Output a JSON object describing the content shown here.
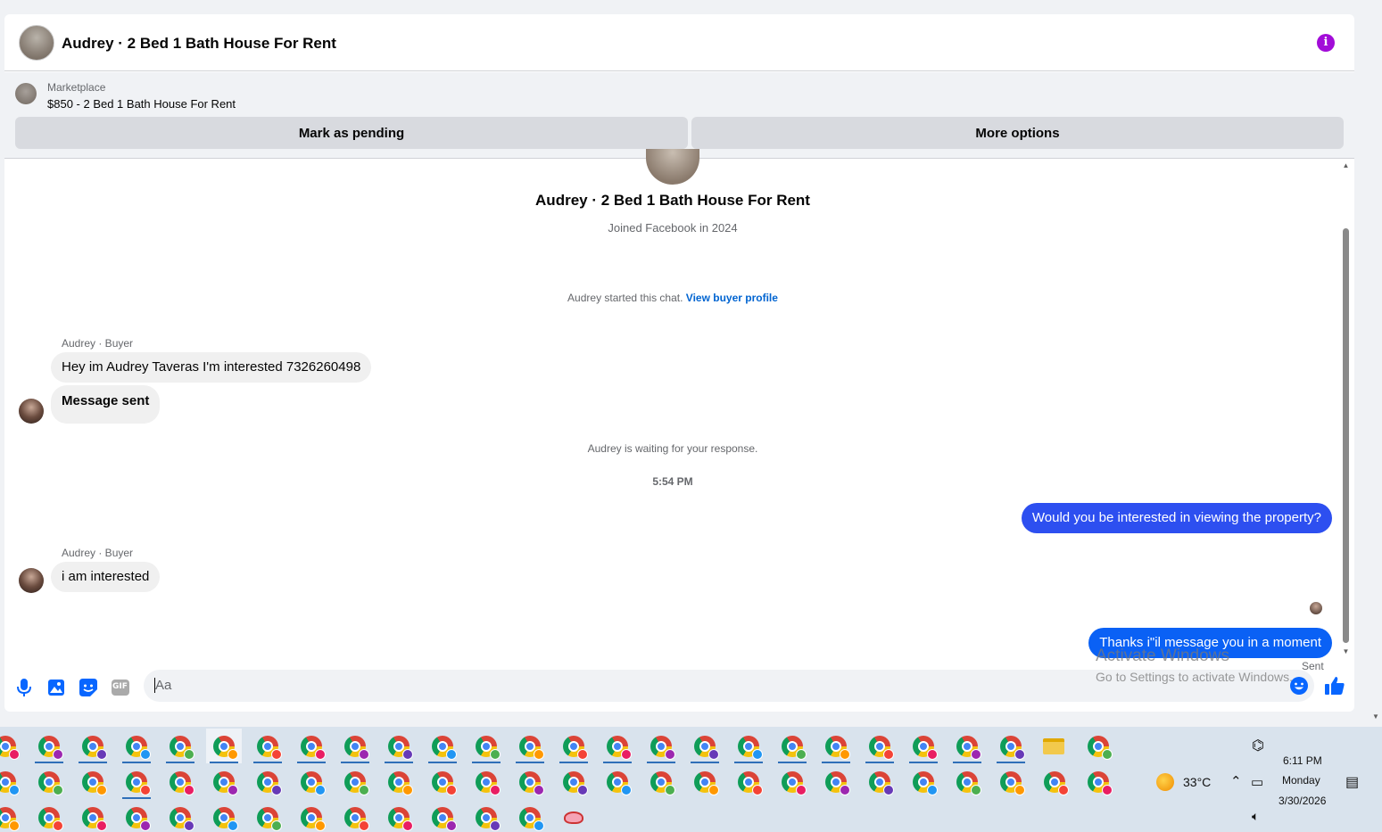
{
  "header": {
    "title": "Audrey · 2 Bed 1 Bath House For Rent",
    "info_icon": "i"
  },
  "listing": {
    "label": "Marketplace",
    "price_title": "$850 - 2 Bed 1 Bath House For Rent",
    "mark_pending": "Mark as pending",
    "more_options": "More options"
  },
  "profile": {
    "name": "Audrey · 2 Bed 1 Bath House For Rent",
    "joined": "Joined Facebook in 2024"
  },
  "chat": {
    "started_prefix": "Audrey started this chat.",
    "view_profile": "View buyer profile",
    "sender1": "Audrey · Buyer",
    "msg1": "Hey im Audrey Taveras I'm interested 7326260498",
    "msg2": "Message sent",
    "waiting": "Audrey is waiting for your response.",
    "time": "5:54 PM",
    "msg3": "Would you be interested in viewing the property?",
    "sender2": "Audrey · Buyer",
    "msg4": "i am interested",
    "msg5": "Thanks i\"il message you in a moment",
    "status": "Sent"
  },
  "composer": {
    "placeholder": "Aa",
    "icons": [
      "microphone-icon",
      "image-icon",
      "sticker-icon",
      "gif-icon",
      "emoji-icon",
      "thumbs-up-icon"
    ],
    "gif_label": "GIF"
  },
  "watermark": {
    "line1": "Activate Windows",
    "line2": "Go to Settings to activate Windows."
  },
  "taskbar": {
    "temperature": "33°C",
    "time": "6:11 PM",
    "day": "Monday",
    "date": "3/30/2026",
    "badge_colors": [
      "#e91e63",
      "#9c27b0",
      "#673ab7",
      "#2196f3",
      "#4caf50",
      "#ff9800",
      "#f44336"
    ]
  },
  "colors": {
    "accent_blue": "#0a61f5",
    "link_blue": "#0064d1",
    "info_purple": "#a20cd8"
  }
}
